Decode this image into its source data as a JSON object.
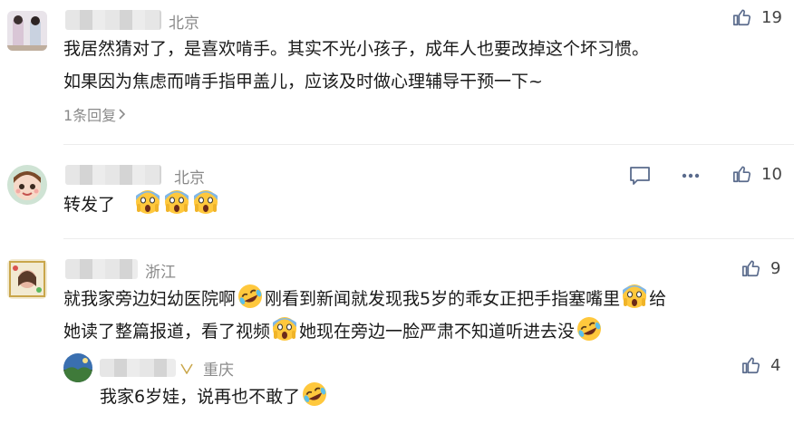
{
  "comments": [
    {
      "location": "北京",
      "likes": "19",
      "lines": [
        "我居然猜对了，是喜欢啃手。其实不光小孩子，成年人也要改掉这个坏习惯。",
        "如果因为焦虑而啃手指甲盖儿，应该及时做心理辅导干预一下~"
      ],
      "reply_count": "1条回复"
    },
    {
      "location": "北京",
      "likes": "10",
      "text": "转发了",
      "emojis": [
        "scream-emoji",
        "scream-emoji",
        "scream-emoji"
      ]
    },
    {
      "location": "浙江",
      "likes": "9",
      "line1": [
        "就我家旁边妇幼医院啊",
        "刚看到新闻就发现我5岁的乖女正把手指塞嘴里",
        "给"
      ],
      "line2": [
        "她读了整篇报道，看了视频",
        "她现在旁边一脸严肃不知道听进去没"
      ]
    }
  ],
  "reply": {
    "location": "重庆",
    "likes": "4",
    "text": "我家6岁娃，说再也不敢了"
  },
  "colors": {
    "accent": "#5a6b8c",
    "muted": "#8a8a8a",
    "text": "#1a1a1a"
  }
}
